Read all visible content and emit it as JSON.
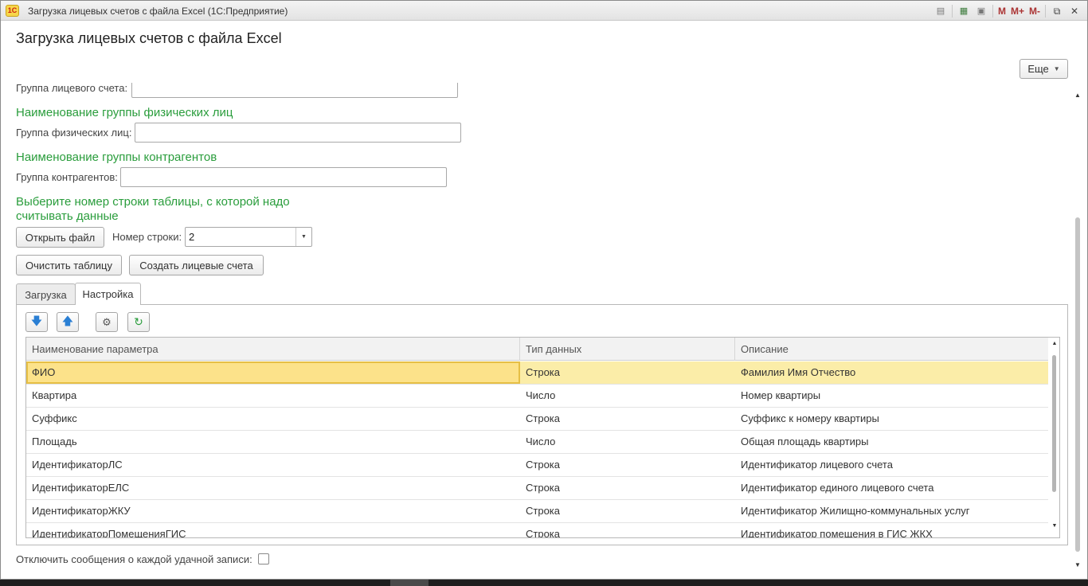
{
  "window": {
    "title": "Загрузка лицевых счетов с файла Excel  (1С:Предприятие)",
    "logo_text": "1С"
  },
  "titlebar_tools": {
    "m_label": "M",
    "m_plus_label": "M+",
    "m_minus_label": "M-",
    "restore_glyph": "⧉",
    "close_glyph": "✕"
  },
  "form": {
    "title": "Загрузка лицевых счетов с файла Excel",
    "more_button": "Еще"
  },
  "fields": {
    "account_group_label": "Группа лицевого счета:",
    "account_group_value": "",
    "person_group_heading": "Наименование группы физических лиц",
    "person_group_label": "Группа физических лиц:",
    "person_group_value": "",
    "counterparty_group_heading": "Наименование группы контрагентов",
    "counterparty_group_label": "Группа контрагентов:",
    "counterparty_group_value": "",
    "row_select_heading_line1": "Выберите номер строки таблицы, с которой надо",
    "row_select_heading_line2": "считывать данные",
    "row_number_label": "Номер строки:",
    "row_number_value": "2"
  },
  "buttons": {
    "open_file": "Открыть файл",
    "clear_table": "Очистить таблицу",
    "create_accounts": "Создать лицевые счета"
  },
  "tabs": [
    {
      "label": "Загрузка",
      "active": false
    },
    {
      "label": "Настройка",
      "active": true
    }
  ],
  "grid": {
    "columns": [
      "Наименование параметра",
      "Тип данных",
      "Описание"
    ],
    "rows": [
      [
        "ФИО",
        "Строка",
        "Фамилия Имя Отчество"
      ],
      [
        "Квартира",
        "Число",
        "Номер квартиры"
      ],
      [
        "Суффикс",
        "Строка",
        "Суффикс к номеру квартиры"
      ],
      [
        "Площадь",
        "Число",
        "Общая площадь квартиры"
      ],
      [
        "ИдентификаторЛС",
        "Строка",
        "Идентификатор лицевого счета"
      ],
      [
        "ИдентификаторЕЛС",
        "Строка",
        "Идентификатор единого лицевого счета"
      ],
      [
        "ИдентификаторЖКУ",
        "Строка",
        "Идентификатор Жилищно-коммунальных услуг"
      ],
      [
        "ИдентификаторПомещенияГИС",
        "Строка",
        "Идентификатор помещения в ГИС ЖКХ"
      ]
    ],
    "selected_row": 0
  },
  "footer": {
    "disable_messages_label": "Отключить сообщения о каждой удачной записи:",
    "disable_messages_checked": false
  },
  "colors": {
    "heading_green": "#2a9d3c",
    "selected_row": "#fbeda8",
    "selected_cell_border": "#e6bf45"
  }
}
